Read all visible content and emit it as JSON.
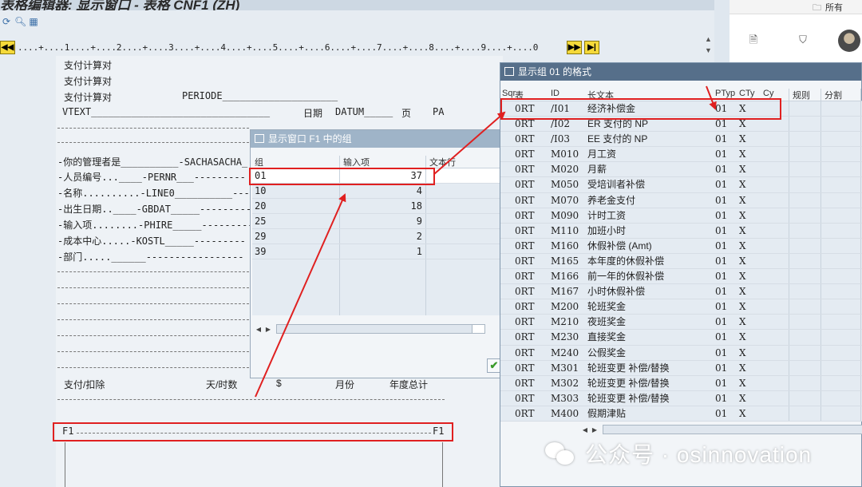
{
  "main": {
    "title": "表格编辑器: 显示窗口 - 表格 CNF1 (ZH)",
    "ruler": "....+....1....+....2....+....3....+....4....+....5....+....6....+....7....+....8....+....9....+....0",
    "form_lines": [
      "支付计算对",
      "支付计算对",
      "支付计算对",
      "PERIODE____________________",
      "VTEXT_______________________________",
      "日期",
      "DATUM_____",
      "页",
      "PA",
      "-你的管理者是__________-SACHASACHA_",
      "-人员编号...____-PERNR___---------",
      "-名称..........-LINE0__________-----",
      "-出生日期..____-GBDAT_____---------",
      "-输入项........-PHIRE_____---------",
      "-成本中心.....-KOSTL_____---------",
      "-部门.....______-----------------",
      "支付/扣除",
      "天/时数",
      "$",
      "月份",
      "年度总计",
      "F1",
      "F1"
    ]
  },
  "dialog_groups": {
    "title": "显示窗口 F1 中的组",
    "headers": [
      "组",
      "输入项",
      "文本行"
    ],
    "rows": [
      {
        "group": "01",
        "count": "37"
      },
      {
        "group": "10",
        "count": "4"
      },
      {
        "group": "20",
        "count": "18"
      },
      {
        "group": "25",
        "count": "9"
      },
      {
        "group": "29",
        "count": "2"
      },
      {
        "group": "39",
        "count": "1"
      }
    ]
  },
  "dialog_format": {
    "title": "显示组 01 的格式",
    "headers": [
      "Sqr",
      "表",
      "ID",
      "长文本",
      "PTyp",
      "CTy",
      "Cy",
      "规则",
      "分割"
    ],
    "rows": [
      {
        "t": "0RT",
        "id": "/I01",
        "text": "经济补偿金",
        "ptyp": "01",
        "cty": "X"
      },
      {
        "t": "0RT",
        "id": "/I02",
        "text": "ER 支付的 NP",
        "ptyp": "01",
        "cty": "X"
      },
      {
        "t": "0RT",
        "id": "/I03",
        "text": "EE 支付的 NP",
        "ptyp": "01",
        "cty": "X"
      },
      {
        "t": "0RT",
        "id": "M010",
        "text": "月工资",
        "ptyp": "01",
        "cty": "X"
      },
      {
        "t": "0RT",
        "id": "M020",
        "text": "月薪",
        "ptyp": "01",
        "cty": "X"
      },
      {
        "t": "0RT",
        "id": "M050",
        "text": "受培训者补偿",
        "ptyp": "01",
        "cty": "X"
      },
      {
        "t": "0RT",
        "id": "M070",
        "text": "养老金支付",
        "ptyp": "01",
        "cty": "X"
      },
      {
        "t": "0RT",
        "id": "M090",
        "text": "计时工资",
        "ptyp": "01",
        "cty": "X"
      },
      {
        "t": "0RT",
        "id": "M110",
        "text": "加班小时",
        "ptyp": "01",
        "cty": "X"
      },
      {
        "t": "0RT",
        "id": "M160",
        "text": "休假补偿 (Amt)",
        "ptyp": "01",
        "cty": "X"
      },
      {
        "t": "0RT",
        "id": "M165",
        "text": "本年度的休假补偿",
        "ptyp": "01",
        "cty": "X"
      },
      {
        "t": "0RT",
        "id": "M166",
        "text": "前一年的休假补偿",
        "ptyp": "01",
        "cty": "X"
      },
      {
        "t": "0RT",
        "id": "M167",
        "text": "小时休假补偿",
        "ptyp": "01",
        "cty": "X"
      },
      {
        "t": "0RT",
        "id": "M200",
        "text": "轮班奖金",
        "ptyp": "01",
        "cty": "X"
      },
      {
        "t": "0RT",
        "id": "M210",
        "text": "夜班奖金",
        "ptyp": "01",
        "cty": "X"
      },
      {
        "t": "0RT",
        "id": "M230",
        "text": "直接奖金",
        "ptyp": "01",
        "cty": "X"
      },
      {
        "t": "0RT",
        "id": "M240",
        "text": "公假奖金",
        "ptyp": "01",
        "cty": "X"
      },
      {
        "t": "0RT",
        "id": "M301",
        "text": "轮班变更 补偿/替换",
        "ptyp": "01",
        "cty": "X"
      },
      {
        "t": "0RT",
        "id": "M302",
        "text": "轮班变更 补偿/替换",
        "ptyp": "01",
        "cty": "X"
      },
      {
        "t": "0RT",
        "id": "M303",
        "text": "轮班变更 补偿/替换",
        "ptyp": "01",
        "cty": "X"
      },
      {
        "t": "0RT",
        "id": "M400",
        "text": "假期津贴",
        "ptyp": "01",
        "cty": "X"
      }
    ]
  },
  "side_panel": {
    "folder_label": "所有"
  },
  "watermark": {
    "text": "公众号 · osinnovation"
  },
  "colors": {
    "annotation_red": "#e02020",
    "dialog_title_blue": "#566f8a"
  }
}
